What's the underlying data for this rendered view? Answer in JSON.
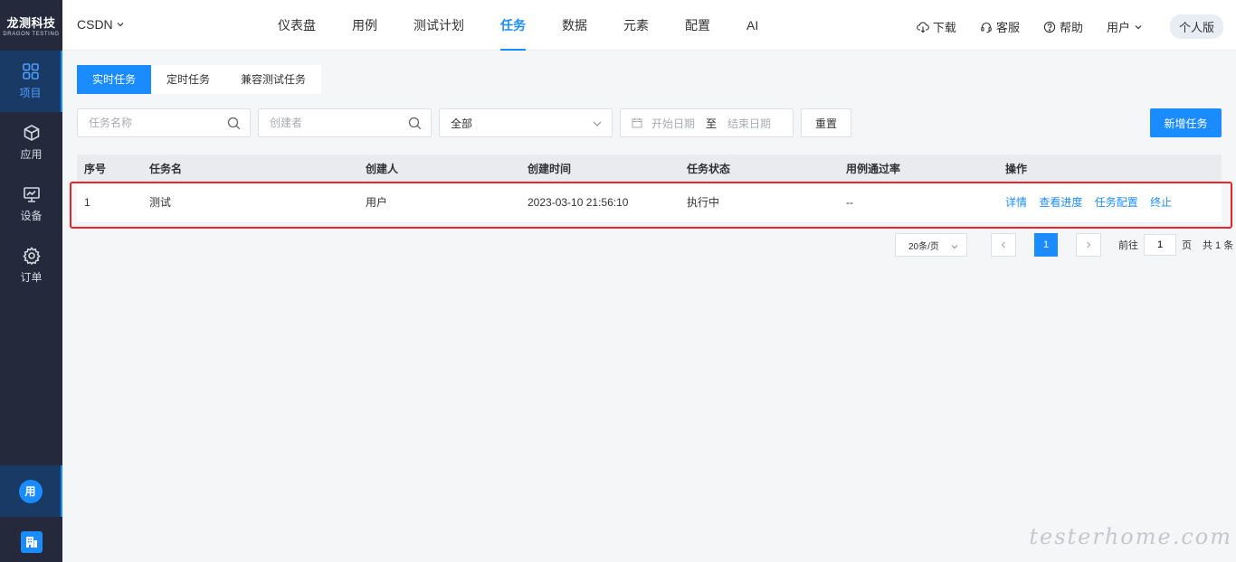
{
  "brand": {
    "name": "龙测科技",
    "sub": "DRAGON TESTING"
  },
  "sidebar": {
    "items": [
      {
        "label": "项目",
        "icon": "grid-icon",
        "active": true
      },
      {
        "label": "应用",
        "icon": "cube-icon",
        "active": false
      },
      {
        "label": "设备",
        "icon": "monitor-icon",
        "active": false
      },
      {
        "label": "订单",
        "icon": "gear-icon",
        "active": false
      }
    ],
    "avatar_text": "用"
  },
  "header": {
    "project": "CSDN",
    "nav": [
      "仪表盘",
      "用例",
      "测试计划",
      "任务",
      "数据",
      "元素",
      "配置",
      "AI"
    ],
    "active_nav": "任务",
    "download": "下载",
    "support": "客服",
    "help": "帮助",
    "user": "用户",
    "edition": "个人版"
  },
  "tabs": [
    "实时任务",
    "定时任务",
    "兼容测试任务"
  ],
  "filters": {
    "task_name_placeholder": "任务名称",
    "creator_placeholder": "创建者",
    "status_value": "全部",
    "start_date_placeholder": "开始日期",
    "date_sep": "至",
    "end_date_placeholder": "结束日期",
    "reset_label": "重置",
    "new_label": "新增任务"
  },
  "table": {
    "headers": [
      "序号",
      "任务名",
      "创建人",
      "创建时间",
      "任务状态",
      "用例通过率",
      "操作"
    ],
    "rows": [
      {
        "index": "1",
        "name": "测试",
        "creator": "用户",
        "created": "2023-03-10 21:56:10",
        "status": "执行中",
        "pass_rate": "--",
        "actions": [
          "详情",
          "查看进度",
          "任务配置",
          "终止"
        ]
      }
    ]
  },
  "pagination": {
    "page_size": "20条/页",
    "current": "1",
    "goto_label": "前往",
    "goto_value": "1",
    "page_unit": "页",
    "total": "共 1 条"
  },
  "watermark": "testerhome.com",
  "colors": {
    "accent": "#1b8cff",
    "sidebar": "#242a3c",
    "highlight": "#e8262a"
  }
}
